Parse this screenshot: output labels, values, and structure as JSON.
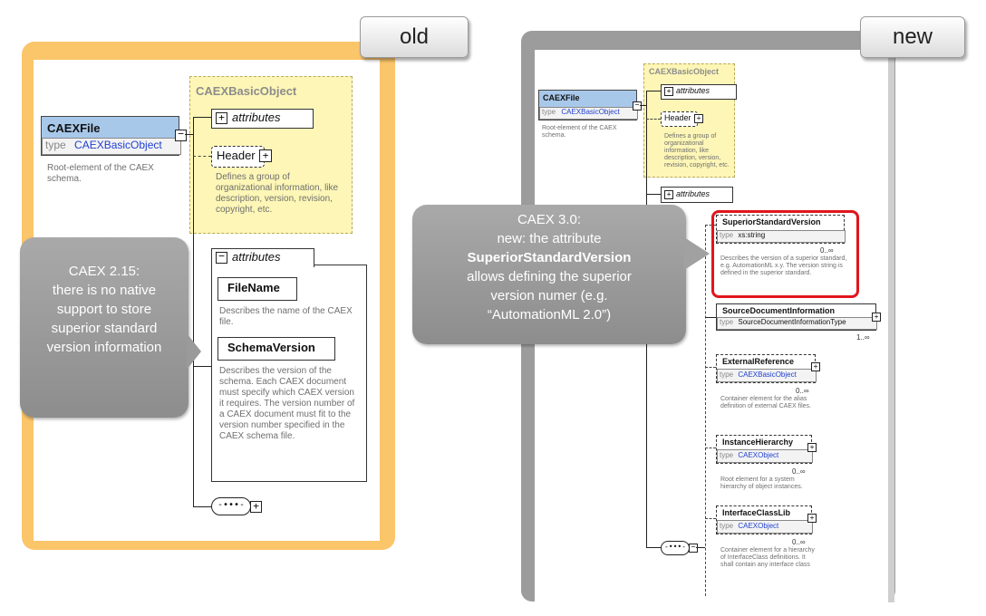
{
  "tabs": {
    "old": "old",
    "new": "new"
  },
  "old": {
    "group_title": "CAEXBasicObject",
    "attributes_label": "attributes",
    "header_label": "Header",
    "header_desc": "Defines a group of organizational information, like description, version, revision, copyright, etc.",
    "caexfile_name": "CAEXFile",
    "caexfile_type_label": "type",
    "caexfile_type_value": "CAEXBasicObject",
    "caexfile_desc": "Root-element of the CAEX schema.",
    "attr_group_label": "attributes",
    "filename_label": "FileName",
    "filename_desc": "Describes the name of the CAEX file.",
    "schemaversion_label": "SchemaVersion",
    "schemaversion_desc": "Describes the version of the schema. Each CAEX document must specify which CAEX version it requires. The version number of a CAEX document must fit to the version number specified in the CAEX schema file.",
    "callout": {
      "line1": "CAEX 2.15:",
      "line2": "there is no native",
      "line3": "support to store",
      "line4": "superior standard",
      "line5": "version information"
    }
  },
  "new": {
    "group_title": "CAEXBasicObject",
    "attributes_label": "attributes",
    "header_label": "Header",
    "header_desc": "Defines a group of organizational information, like description, version, revision, copyright, etc.",
    "caexfile_name": "CAEXFile",
    "caexfile_type_label": "type",
    "caexfile_type_value": "CAEXBasicObject",
    "caexfile_desc": "Root-element of the CAEX schema.",
    "attributes2_label": "attributes",
    "ssv": {
      "name": "SuperiorStandardVersion",
      "type_label": "type",
      "type_value": "xs:string",
      "mult": "0..∞",
      "desc": "Describes the version of a superior standard, e.g. AutomationML x.y. The version string is defined in the superior standard."
    },
    "sdi": {
      "name": "SourceDocumentInformation",
      "type_label": "type",
      "type_value": "SourceDocumentInformationType",
      "mult": "1..∞"
    },
    "extref": {
      "name": "ExternalReference",
      "type_label": "type",
      "type_value": "CAEXBasicObject",
      "mult": "0..∞",
      "desc": "Container element for the alias definition of external CAEX files."
    },
    "ih": {
      "name": "InstanceHierarchy",
      "type_label": "type",
      "type_value": "CAEXObject",
      "mult": "0..∞",
      "desc": "Root element for a system hierarchy of object instances."
    },
    "icl": {
      "name": "InterfaceClassLib",
      "type_label": "type",
      "type_value": "CAEXObject",
      "mult": "0..∞",
      "desc": "Container element for a hierarchy of InterfaceClass definitions. It shall contain any interface class"
    },
    "callout": {
      "line1": "CAEX 3.0:",
      "line2": "new: the attribute",
      "line3": "SuperiorStandardVersion",
      "line4": "allows defining the superior",
      "line5": "version numer (e.g.",
      "line6": "“AutomationML 2.0”)"
    }
  }
}
